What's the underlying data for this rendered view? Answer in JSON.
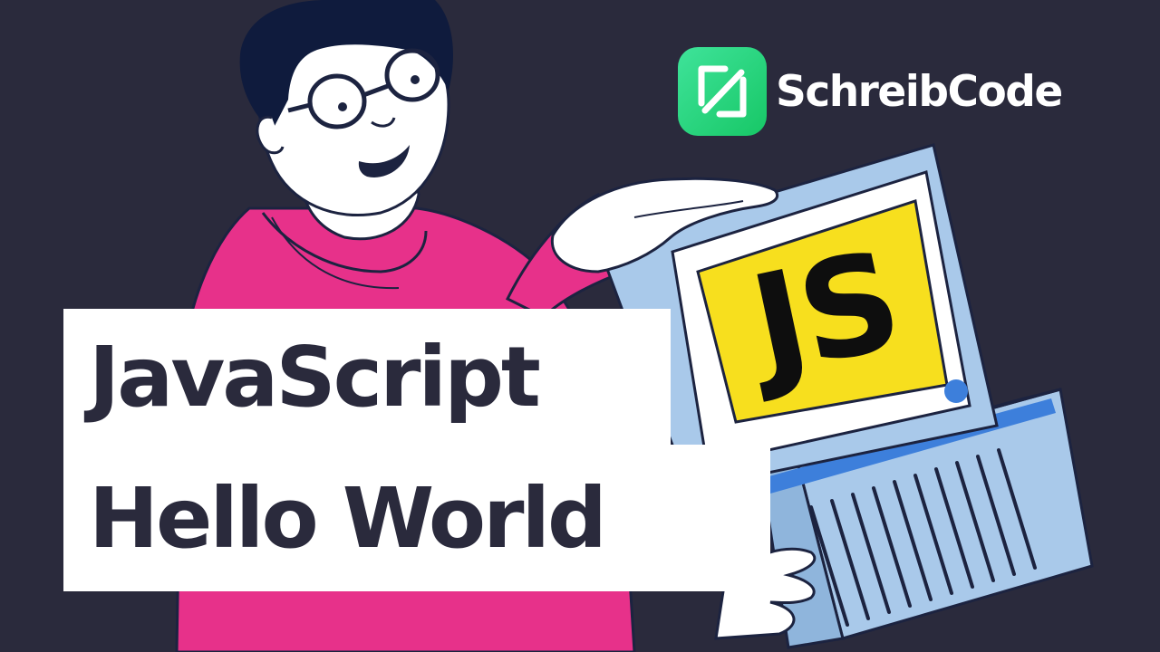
{
  "brand": {
    "name": "SchreibCode",
    "logo_icon": "schreibcode-logo-icon"
  },
  "title": {
    "line1": "JavaScript",
    "line2": "Hello World"
  },
  "computer": {
    "screen_label": "JS"
  },
  "colors": {
    "background": "#2a2a3c",
    "sweater": "#e7318a",
    "monitor": "#a9c9ea",
    "js_yellow": "#f7df1e",
    "accent_blue": "#3d7fdb",
    "logo_green": "#2fd876"
  }
}
